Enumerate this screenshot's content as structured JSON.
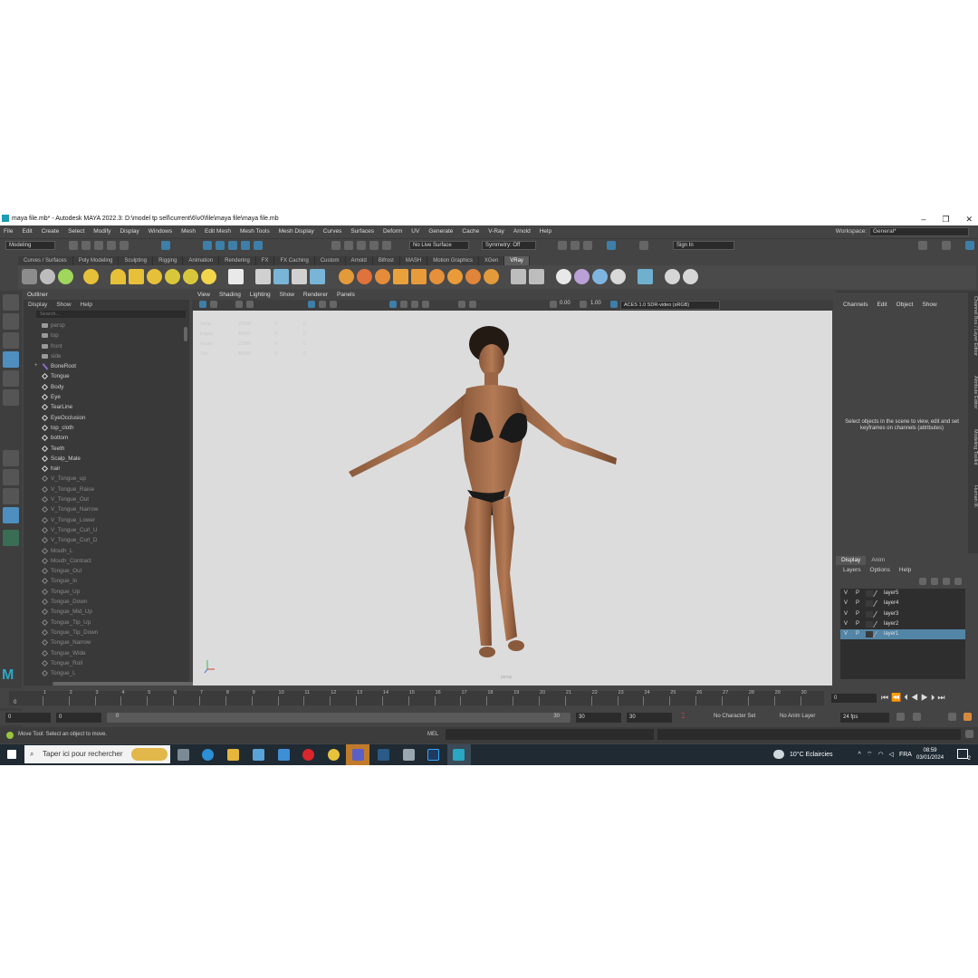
{
  "window": {
    "title": "maya file.mb* - Autodesk MAYA 2022.3: D:\\model tp sell\\current\\6\\v0\\file\\maya file\\maya file.mb",
    "minimize": "–",
    "maximize": "❐",
    "close": "✕"
  },
  "menubar": {
    "items": [
      "File",
      "Edit",
      "Create",
      "Select",
      "Modify",
      "Display",
      "Windows",
      "Mesh",
      "Edit Mesh",
      "Mesh Tools",
      "Mesh Display",
      "Curves",
      "Surfaces",
      "Deform",
      "UV",
      "Generate",
      "Cache",
      "V-Ray",
      "Arnold",
      "Help"
    ],
    "workspace_label": "Workspace:",
    "workspace_value": "General*"
  },
  "statusline": {
    "mode": "Modeling",
    "live_surface": "No Live Surface",
    "symmetry": "Symmetry: Off",
    "sign_in": "Sign In"
  },
  "shelf": {
    "tabs": [
      "Curves / Surfaces",
      "Poly Modeling",
      "Sculpting",
      "Rigging",
      "Animation",
      "Rendering",
      "FX",
      "FX Caching",
      "Custom",
      "Arnold",
      "Bifrost",
      "MASH",
      "Motion Graphics",
      "XGen",
      "VRay"
    ],
    "active_tab": "VRay"
  },
  "outliner": {
    "title": "Outliner",
    "menu": [
      "Display",
      "Show",
      "Help"
    ],
    "search_placeholder": "Search...",
    "items": [
      {
        "name": "persp",
        "type": "cam",
        "dim": true
      },
      {
        "name": "top",
        "type": "cam",
        "dim": true
      },
      {
        "name": "front",
        "type": "cam",
        "dim": true
      },
      {
        "name": "side",
        "type": "cam",
        "dim": true
      },
      {
        "name": "BoneRoot",
        "type": "joint",
        "dim": false,
        "expand": "+"
      },
      {
        "name": "Tongue",
        "type": "mesh",
        "dim": false
      },
      {
        "name": "Body",
        "type": "mesh",
        "dim": false
      },
      {
        "name": "Eye",
        "type": "mesh",
        "dim": false
      },
      {
        "name": "TearLine",
        "type": "mesh",
        "dim": false
      },
      {
        "name": "EyeOcclusion",
        "type": "mesh",
        "dim": false
      },
      {
        "name": "top_cloth",
        "type": "mesh",
        "dim": false
      },
      {
        "name": "bottom",
        "type": "mesh",
        "dim": false
      },
      {
        "name": "Teeth",
        "type": "mesh",
        "dim": false
      },
      {
        "name": "Scalp_Male",
        "type": "mesh",
        "dim": false
      },
      {
        "name": "hair",
        "type": "mesh",
        "dim": false
      },
      {
        "name": "V_Tongue_up",
        "type": "mesh",
        "dim": true
      },
      {
        "name": "V_Tongue_Raise",
        "type": "mesh",
        "dim": true
      },
      {
        "name": "V_Tongue_Out",
        "type": "mesh",
        "dim": true
      },
      {
        "name": "V_Tongue_Narrow",
        "type": "mesh",
        "dim": true
      },
      {
        "name": "V_Tongue_Lower",
        "type": "mesh",
        "dim": true
      },
      {
        "name": "V_Tongue_Curl_U",
        "type": "mesh",
        "dim": true
      },
      {
        "name": "V_Tongue_Curl_D",
        "type": "mesh",
        "dim": true
      },
      {
        "name": "Mouth_L",
        "type": "mesh",
        "dim": true
      },
      {
        "name": "Mouth_Contract",
        "type": "mesh",
        "dim": true
      },
      {
        "name": "Tongue_Out",
        "type": "mesh",
        "dim": true
      },
      {
        "name": "Tongue_In",
        "type": "mesh",
        "dim": true
      },
      {
        "name": "Tongue_Up",
        "type": "mesh",
        "dim": true
      },
      {
        "name": "Tongue_Down",
        "type": "mesh",
        "dim": true
      },
      {
        "name": "Tongue_Mid_Up",
        "type": "mesh",
        "dim": true
      },
      {
        "name": "Tongue_Tip_Up",
        "type": "mesh",
        "dim": true
      },
      {
        "name": "Tongue_Tip_Down",
        "type": "mesh",
        "dim": true
      },
      {
        "name": "Tongue_Narrow",
        "type": "mesh",
        "dim": true
      },
      {
        "name": "Tongue_Wide",
        "type": "mesh",
        "dim": true
      },
      {
        "name": "Tongue_Roll",
        "type": "mesh",
        "dim": true
      },
      {
        "name": "Tongue_L",
        "type": "mesh",
        "dim": true
      }
    ]
  },
  "viewport": {
    "menu": [
      "View",
      "Shading",
      "Lighting",
      "Show",
      "Renderer",
      "Panels"
    ],
    "exposure": "0.00",
    "gamma": "1.00",
    "color_space": "ACES 1.0 SDR-video (sRGB)",
    "hud": [
      {
        "label": "Verts:",
        "value": "22308",
        "a": "0",
        "b": "0"
      },
      {
        "label": "Edges:",
        "value": "44550",
        "a": "0",
        "b": "0"
      },
      {
        "label": "Faces:",
        "value": "22286",
        "a": "0",
        "b": "0"
      },
      {
        "label": "Tris:",
        "value": "44286",
        "a": "0",
        "b": "0"
      }
    ],
    "camera_label": "persp"
  },
  "channelbox": {
    "menu": [
      "Channels",
      "Edit",
      "Object",
      "Show"
    ],
    "message": "Select objects in the scene to view, edit and set keyframes on channels (attributes)",
    "side_tabs": [
      "Channel Box / Layer Editor",
      "Attribute Editor",
      "Modeling Toolkit",
      "Human IK"
    ]
  },
  "layers": {
    "tabs": [
      "Display",
      "Anim"
    ],
    "active_tab": "Display",
    "menu": [
      "Layers",
      "Options",
      "Help"
    ],
    "items": [
      {
        "v": "V",
        "p": "P",
        "name": "layer5",
        "selected": false
      },
      {
        "v": "V",
        "p": "P",
        "name": "layer4",
        "selected": false
      },
      {
        "v": "V",
        "p": "P",
        "name": "layer3",
        "selected": false
      },
      {
        "v": "V",
        "p": "P",
        "name": "layer2",
        "selected": false
      },
      {
        "v": "V",
        "p": "P",
        "name": "layer1",
        "selected": true
      }
    ]
  },
  "timeslider": {
    "ticks": [
      "1",
      "2",
      "3",
      "4",
      "5",
      "6",
      "7",
      "8",
      "9",
      "10",
      "11",
      "12",
      "13",
      "14",
      "15",
      "16",
      "17",
      "18",
      "19",
      "20",
      "21",
      "22",
      "23",
      "24",
      "25",
      "26",
      "27",
      "28",
      "29",
      "30"
    ],
    "current_frame": "0",
    "frame_marker": "0",
    "range_start": "0",
    "range_start2": "0",
    "range_inner_start": "0",
    "range_inner_end": "30",
    "range_end": "30",
    "range_end2": "30",
    "character_set": "No Character Set",
    "anim_layer": "No Anim Layer",
    "fps": "24 fps"
  },
  "helpline": {
    "message": "Move Tool: Select an object to move.",
    "script_lang": "MEL"
  },
  "taskbar": {
    "search_placeholder": "Taper ici pour rechercher",
    "weather": "10°C  Eclaircies",
    "language": "FRA",
    "time": "08:59",
    "date": "03/01/2024",
    "notifications": "2"
  }
}
